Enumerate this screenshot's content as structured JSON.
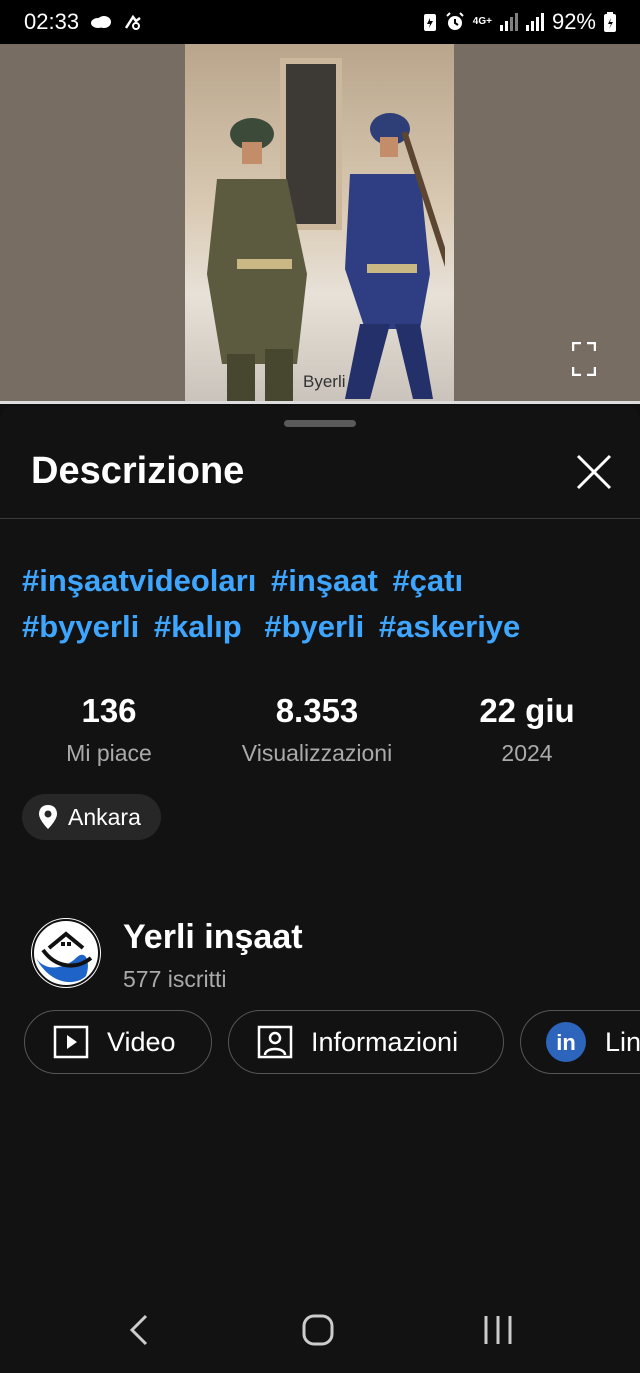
{
  "status_bar": {
    "time": "02:33",
    "network": "4G+",
    "battery": "92%",
    "icons": [
      "cloud-icon",
      "cast-icon",
      "battery-saver-icon",
      "alarm-icon",
      "signal-icon",
      "battery-icon"
    ]
  },
  "video": {
    "watermark": "Byerli",
    "progress_fraction": 1.0,
    "fullscreen_icon": "fullscreen-icon"
  },
  "sheet": {
    "title": "Descrizione",
    "close_icon": "close-icon"
  },
  "hashtags": [
    "#inşaatvideoları",
    "#inşaat",
    "#çatı",
    "#byyerli",
    "#kalıp",
    "#byerli",
    "#askeriye"
  ],
  "stats": [
    {
      "value": "136",
      "label": "Mi piace"
    },
    {
      "value": "8.353",
      "label": "Visualizzazioni"
    },
    {
      "value": "22 giu",
      "label": "2024"
    }
  ],
  "location": {
    "label": "Ankara",
    "icon": "location-pin-icon"
  },
  "channel": {
    "name": "Yerli inşaat",
    "subscribers": "577 iscritti"
  },
  "buttons": [
    {
      "label": "Video",
      "icon": "play-icon"
    },
    {
      "label": "Informazioni",
      "icon": "person-icon"
    },
    {
      "label": "Lin",
      "icon": "linkedin-icon"
    }
  ],
  "colors": {
    "background": "#0f0f0f",
    "hashtag": "#3ea6ff",
    "secondary_text": "#aaaaaa",
    "linkedin": "#2d64bc"
  },
  "nav_bar": {
    "icons": [
      "back-icon",
      "home-icon",
      "recents-icon"
    ]
  }
}
